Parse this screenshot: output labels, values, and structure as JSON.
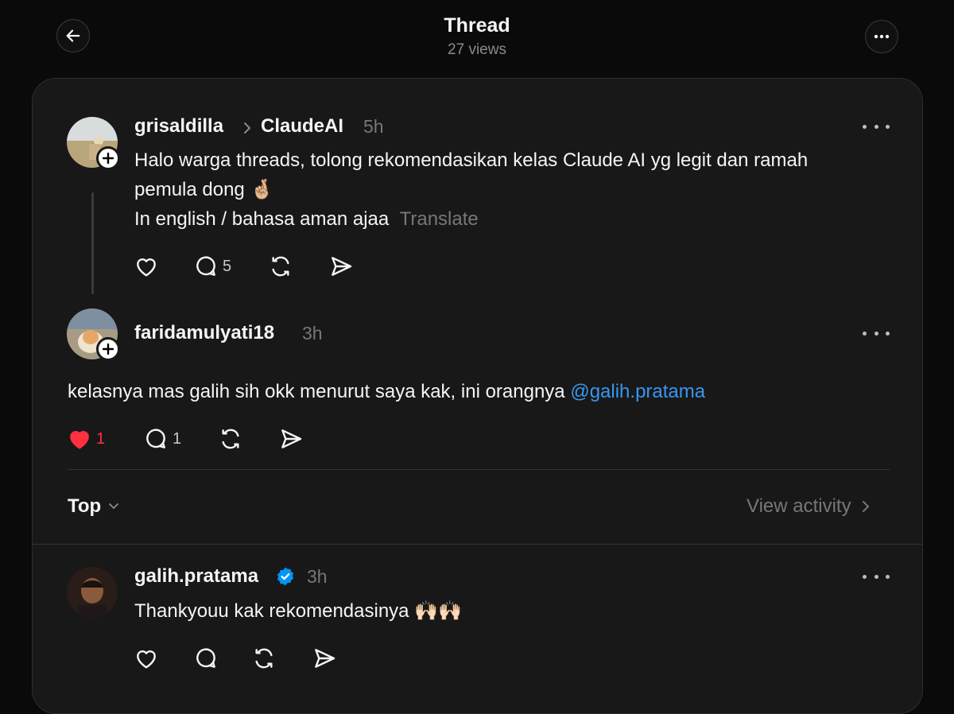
{
  "header": {
    "title": "Thread",
    "views": "27 views"
  },
  "posts": [
    {
      "username": "grisaldilla",
      "community": "ClaudeAI",
      "time": "5h",
      "text_line1": "Halo warga threads, tolong rekomendasikan kelas Claude AI yg legit dan ramah",
      "text_line2": "pemula dong",
      "emoji": "🤞🏼",
      "text_line3": "In english / bahasa aman ajaa",
      "translate": "Translate",
      "reply_count": "5"
    },
    {
      "username": "faridamulyati18",
      "time": "3h",
      "text": "kelasnya mas galih sih okk menurut saya kak, ini orangnya ",
      "mention": "@galih.pratama",
      "like_count": "1",
      "reply_count": "1"
    },
    {
      "username": "galih.pratama",
      "time": "3h",
      "text": "Thankyouu kak rekomendasinya ",
      "emoji": "🙌🏻🙌🏻"
    }
  ],
  "sort": {
    "label": "Top",
    "view_activity": "View activity"
  },
  "colors": {
    "background": "#0a0a0a",
    "card": "#181818",
    "like_red": "#ff3040",
    "link_blue": "#3797f0",
    "verified_blue": "#0095f6"
  }
}
